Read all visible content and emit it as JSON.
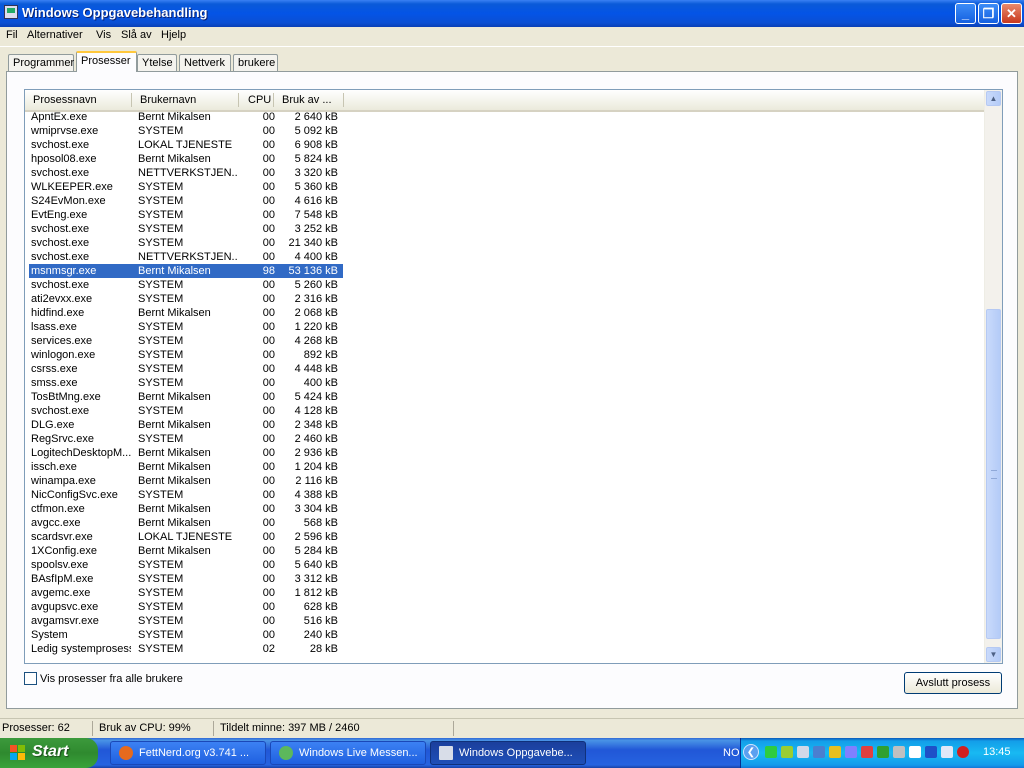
{
  "window": {
    "title": "Windows Oppgavebehandling",
    "minimize": "_",
    "maximize": "❐",
    "close": "✕"
  },
  "menu": [
    "Fil",
    "Alternativer",
    "Vis",
    "Slå av",
    "Hjelp"
  ],
  "tabs": [
    "Programmer",
    "Prosesser",
    "Ytelse",
    "Nettverk",
    "brukere"
  ],
  "active_tab": "Prosesser",
  "columns": [
    "Prosessnavn",
    "Brukernavn",
    "CPU",
    "Bruk av ..."
  ],
  "processes": [
    [
      "ApntEx.exe",
      "Bernt Mikalsen",
      "00",
      "2 640 kB"
    ],
    [
      "wmiprvse.exe",
      "SYSTEM",
      "00",
      "5 092 kB"
    ],
    [
      "svchost.exe",
      "LOKAL TJENESTE",
      "00",
      "6 908 kB"
    ],
    [
      "hposol08.exe",
      "Bernt Mikalsen",
      "00",
      "5 824 kB"
    ],
    [
      "svchost.exe",
      "NETTVERKSTJEN...",
      "00",
      "3 320 kB"
    ],
    [
      "WLKEEPER.exe",
      "SYSTEM",
      "00",
      "5 360 kB"
    ],
    [
      "S24EvMon.exe",
      "SYSTEM",
      "00",
      "4 616 kB"
    ],
    [
      "EvtEng.exe",
      "SYSTEM",
      "00",
      "7 548 kB"
    ],
    [
      "svchost.exe",
      "SYSTEM",
      "00",
      "3 252 kB"
    ],
    [
      "svchost.exe",
      "SYSTEM",
      "00",
      "21 340 kB"
    ],
    [
      "svchost.exe",
      "NETTVERKSTJEN...",
      "00",
      "4 400 kB"
    ],
    [
      "msnmsgr.exe",
      "Bernt Mikalsen",
      "98",
      "53 136 kB"
    ],
    [
      "svchost.exe",
      "SYSTEM",
      "00",
      "5 260 kB"
    ],
    [
      "ati2evxx.exe",
      "SYSTEM",
      "00",
      "2 316 kB"
    ],
    [
      "hidfind.exe",
      "Bernt Mikalsen",
      "00",
      "2 068 kB"
    ],
    [
      "lsass.exe",
      "SYSTEM",
      "00",
      "1 220 kB"
    ],
    [
      "services.exe",
      "SYSTEM",
      "00",
      "4 268 kB"
    ],
    [
      "winlogon.exe",
      "SYSTEM",
      "00",
      "892 kB"
    ],
    [
      "csrss.exe",
      "SYSTEM",
      "00",
      "4 448 kB"
    ],
    [
      "smss.exe",
      "SYSTEM",
      "00",
      "400 kB"
    ],
    [
      "TosBtMng.exe",
      "Bernt Mikalsen",
      "00",
      "5 424 kB"
    ],
    [
      "svchost.exe",
      "SYSTEM",
      "00",
      "4 128 kB"
    ],
    [
      "DLG.exe",
      "Bernt Mikalsen",
      "00",
      "2 348 kB"
    ],
    [
      "RegSrvc.exe",
      "SYSTEM",
      "00",
      "2 460 kB"
    ],
    [
      "LogitechDesktopM...",
      "Bernt Mikalsen",
      "00",
      "2 936 kB"
    ],
    [
      "issch.exe",
      "Bernt Mikalsen",
      "00",
      "1 204 kB"
    ],
    [
      "winampa.exe",
      "Bernt Mikalsen",
      "00",
      "2 116 kB"
    ],
    [
      "NicConfigSvc.exe",
      "SYSTEM",
      "00",
      "4 388 kB"
    ],
    [
      "ctfmon.exe",
      "Bernt Mikalsen",
      "00",
      "3 304 kB"
    ],
    [
      "avgcc.exe",
      "Bernt Mikalsen",
      "00",
      "568 kB"
    ],
    [
      "scardsvr.exe",
      "LOKAL TJENESTE",
      "00",
      "2 596 kB"
    ],
    [
      "1XConfig.exe",
      "Bernt Mikalsen",
      "00",
      "5 284 kB"
    ],
    [
      "spoolsv.exe",
      "SYSTEM",
      "00",
      "5 640 kB"
    ],
    [
      "BAsfIpM.exe",
      "SYSTEM",
      "00",
      "3 312 kB"
    ],
    [
      "avgemc.exe",
      "SYSTEM",
      "00",
      "1 812 kB"
    ],
    [
      "avgupsvc.exe",
      "SYSTEM",
      "00",
      "628 kB"
    ],
    [
      "avgamsvr.exe",
      "SYSTEM",
      "00",
      "516 kB"
    ],
    [
      "System",
      "SYSTEM",
      "00",
      "240 kB"
    ],
    [
      "Ledig systemprosess",
      "SYSTEM",
      "02",
      "28 kB"
    ]
  ],
  "selected_process": "msnmsgr.exe",
  "show_all_label": "Vis prosesser fra alle brukere",
  "end_process_label": "Avslutt prosess",
  "status": {
    "processes": "Prosesser: 62",
    "cpu": "Bruk av CPU: 99%",
    "memory": "Tildelt minne: 397 MB / 2460"
  },
  "taskbar": {
    "start": "Start",
    "tasks": [
      "FettNerd.org v3.741 ...",
      "Windows Live Messen...",
      "Windows Oppgavebe..."
    ],
    "active_task": 2,
    "lang": "NO",
    "clock": "13:45"
  },
  "colors": {
    "selection": "#316ac5",
    "title_bar": "#0454e6",
    "tray": "#18b9f2"
  }
}
